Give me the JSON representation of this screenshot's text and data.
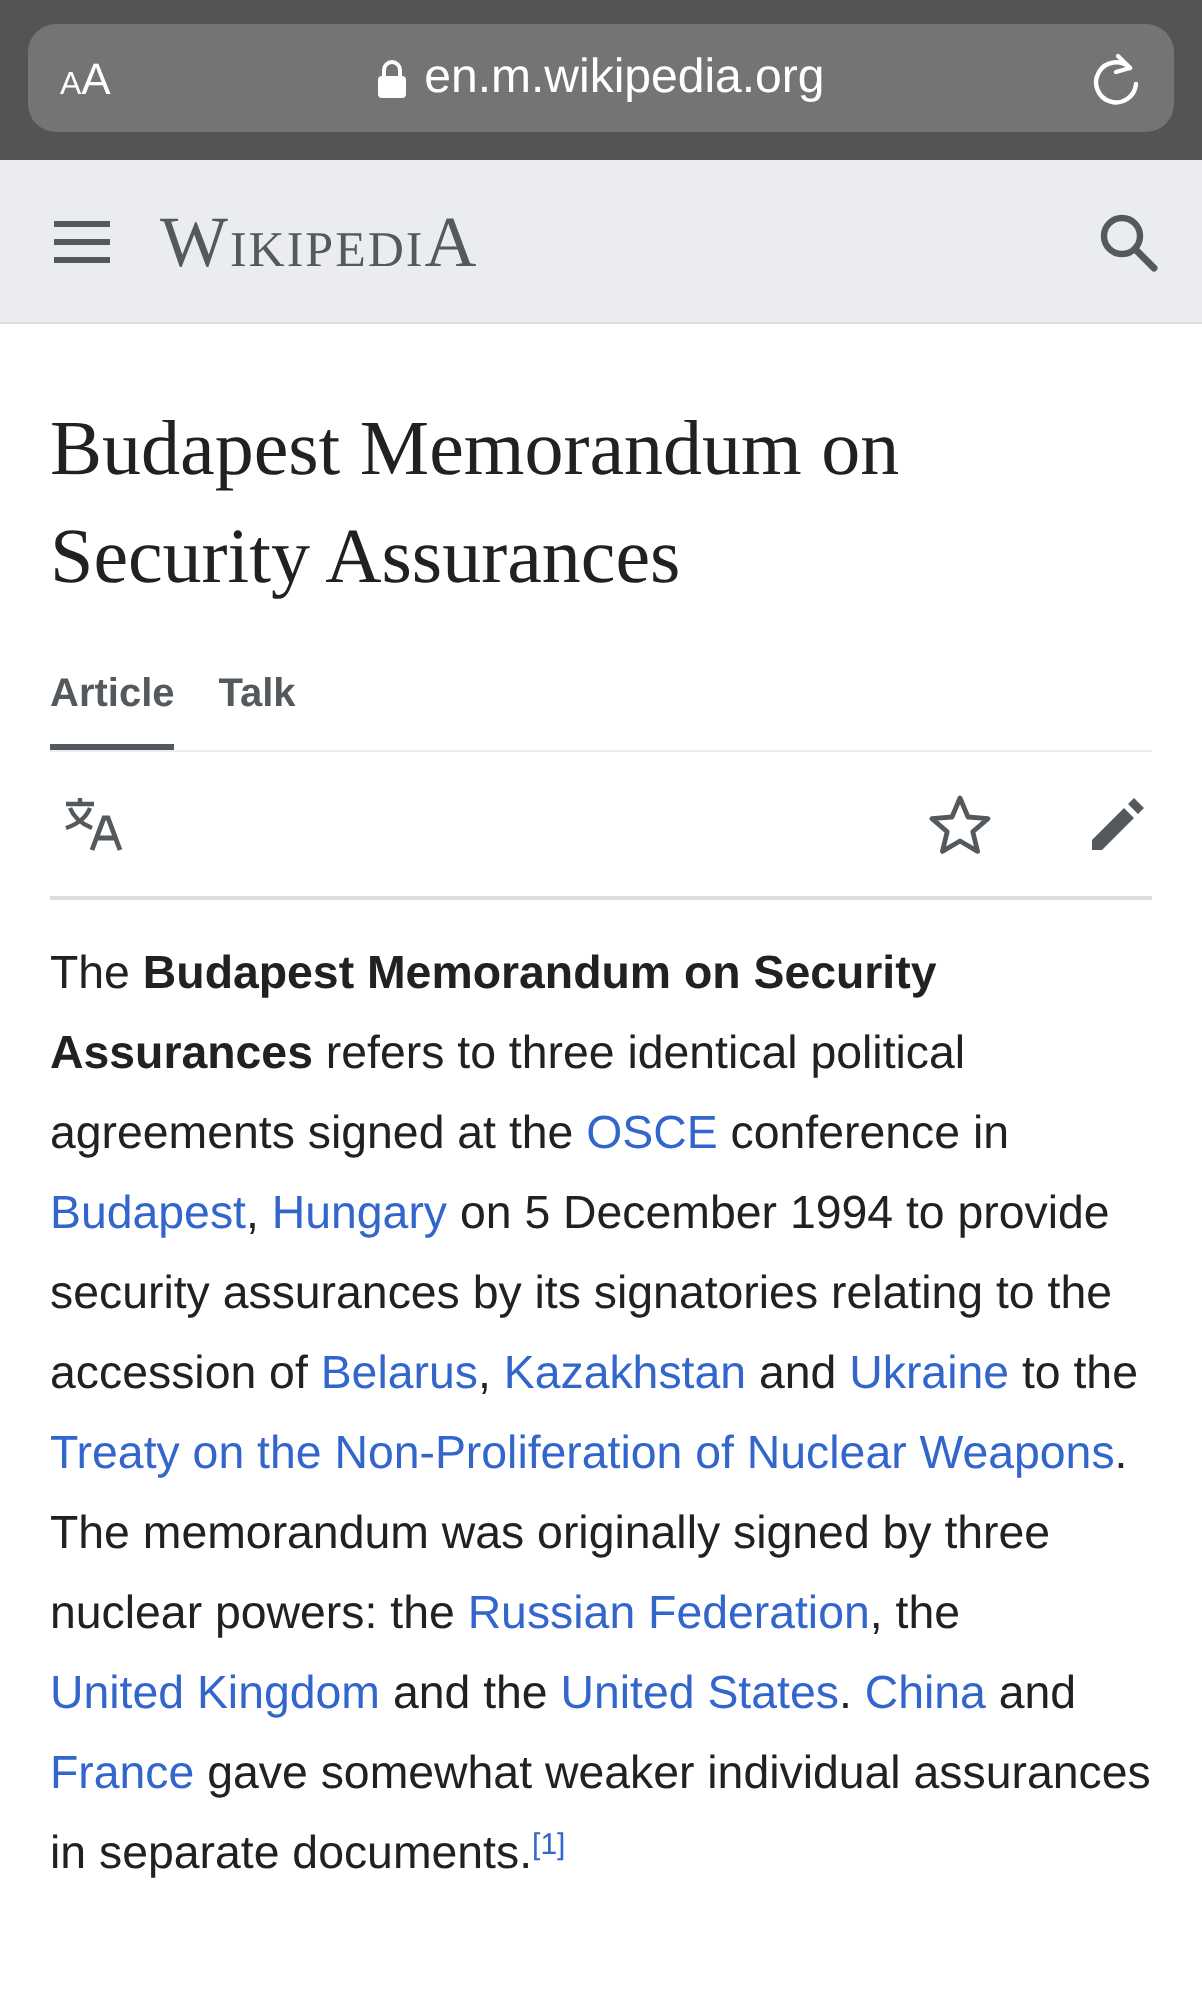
{
  "browser_bar": {
    "text_size_label": "AA",
    "url": "en.m.wikipedia.org"
  },
  "header": {
    "logo": "WikipediA"
  },
  "title": "Budapest Memorandum on Security Assurances",
  "tabs": [
    {
      "label": "Article",
      "selected": true
    },
    {
      "label": "Talk",
      "selected": false
    }
  ],
  "toolbar": {
    "watched": false
  },
  "paragraph": [
    {
      "kind": "plain",
      "text": "The "
    },
    {
      "kind": "bold",
      "text": "Budapest Memorandum on Security Assurances"
    },
    {
      "kind": "plain",
      "text": " refers to three identical political agreements signed at the "
    },
    {
      "kind": "link",
      "text": "OSCE"
    },
    {
      "kind": "plain",
      "text": " conference in "
    },
    {
      "kind": "link",
      "text": "Budapest"
    },
    {
      "kind": "plain",
      "text": ", "
    },
    {
      "kind": "link",
      "text": "Hungary"
    },
    {
      "kind": "plain",
      "text": " on 5 December 1994 to provide security assurances by its signatories relating to the accession of "
    },
    {
      "kind": "link",
      "text": "Belarus"
    },
    {
      "kind": "plain",
      "text": ", "
    },
    {
      "kind": "link",
      "text": "Kazakhstan"
    },
    {
      "kind": "plain",
      "text": " and "
    },
    {
      "kind": "link",
      "text": "Ukraine"
    },
    {
      "kind": "plain",
      "text": " to the "
    },
    {
      "kind": "link",
      "text": "Treaty on the Non-Proliferation of Nuclear Weapons"
    },
    {
      "kind": "plain",
      "text": ". The memorandum was originally signed by three nuclear powers: the "
    },
    {
      "kind": "link",
      "text": "Russian Federation"
    },
    {
      "kind": "plain",
      "text": ", the "
    },
    {
      "kind": "link",
      "text": "United Kingdom"
    },
    {
      "kind": "plain",
      "text": " and the "
    },
    {
      "kind": "link",
      "text": "United States"
    },
    {
      "kind": "plain",
      "text": ". "
    },
    {
      "kind": "link",
      "text": "China"
    },
    {
      "kind": "plain",
      "text": " and "
    },
    {
      "kind": "link",
      "text": "France"
    },
    {
      "kind": "plain",
      "text": " gave somewhat weaker individual assurances in separate documents."
    },
    {
      "kind": "ref",
      "text": "[1]"
    }
  ]
}
